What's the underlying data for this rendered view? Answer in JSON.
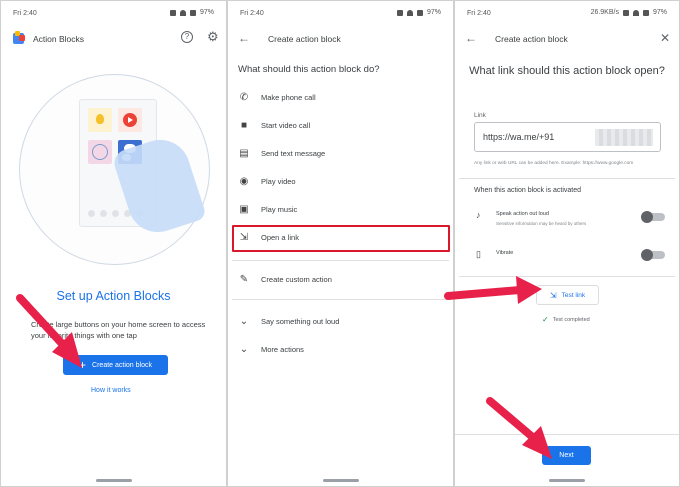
{
  "status_bar": {
    "time": "Fri 2:40",
    "battery": "97%",
    "network_speed": "26.9KB/s"
  },
  "screen1": {
    "app_title": "Action Blocks",
    "help_icon": "help-circle-icon",
    "settings_icon": "gear-icon",
    "heading": "Set up Action Blocks",
    "description": "Create large buttons on your home screen to access your favorite things with one tap",
    "primary_button": "Create action block",
    "link": "How it works"
  },
  "screen2": {
    "title": "Create action block",
    "question": "What should this action block do?",
    "actions": [
      {
        "label": "Make phone call",
        "icon": "phone-icon"
      },
      {
        "label": "Start video call",
        "icon": "video-call-icon"
      },
      {
        "label": "Send text message",
        "icon": "message-icon"
      },
      {
        "label": "Play video",
        "icon": "play-circle-icon"
      },
      {
        "label": "Play music",
        "icon": "music-library-icon"
      },
      {
        "label": "Open a link",
        "icon": "open-link-icon"
      }
    ],
    "custom_action": {
      "label": "Create custom action",
      "icon": "pencil-icon"
    },
    "expanders": [
      {
        "label": "Say something out loud",
        "icon": "chevron-down-icon"
      },
      {
        "label": "More actions",
        "icon": "chevron-down-icon"
      }
    ],
    "highlight_color": "#d9182b"
  },
  "screen3": {
    "title": "Create action block",
    "question": "What link should this action block open?",
    "field_label": "Link",
    "field_value": "https://wa.me/+91",
    "hint": "Any link or web URL can be added here. Example: https://www.google.com",
    "section_title": "When this action block is activated",
    "options": [
      {
        "label": "Speak action out loud",
        "sub": "Sensitive information may be heard by others",
        "icon": "speaker-icon"
      },
      {
        "label": "Vibrate",
        "sub": "",
        "icon": "vibrate-icon"
      }
    ],
    "test_button": "Test link",
    "test_status": "Test completed",
    "next_button": "Next"
  },
  "accent_color": "#1a73e8",
  "arrow_color": "#e8214b"
}
